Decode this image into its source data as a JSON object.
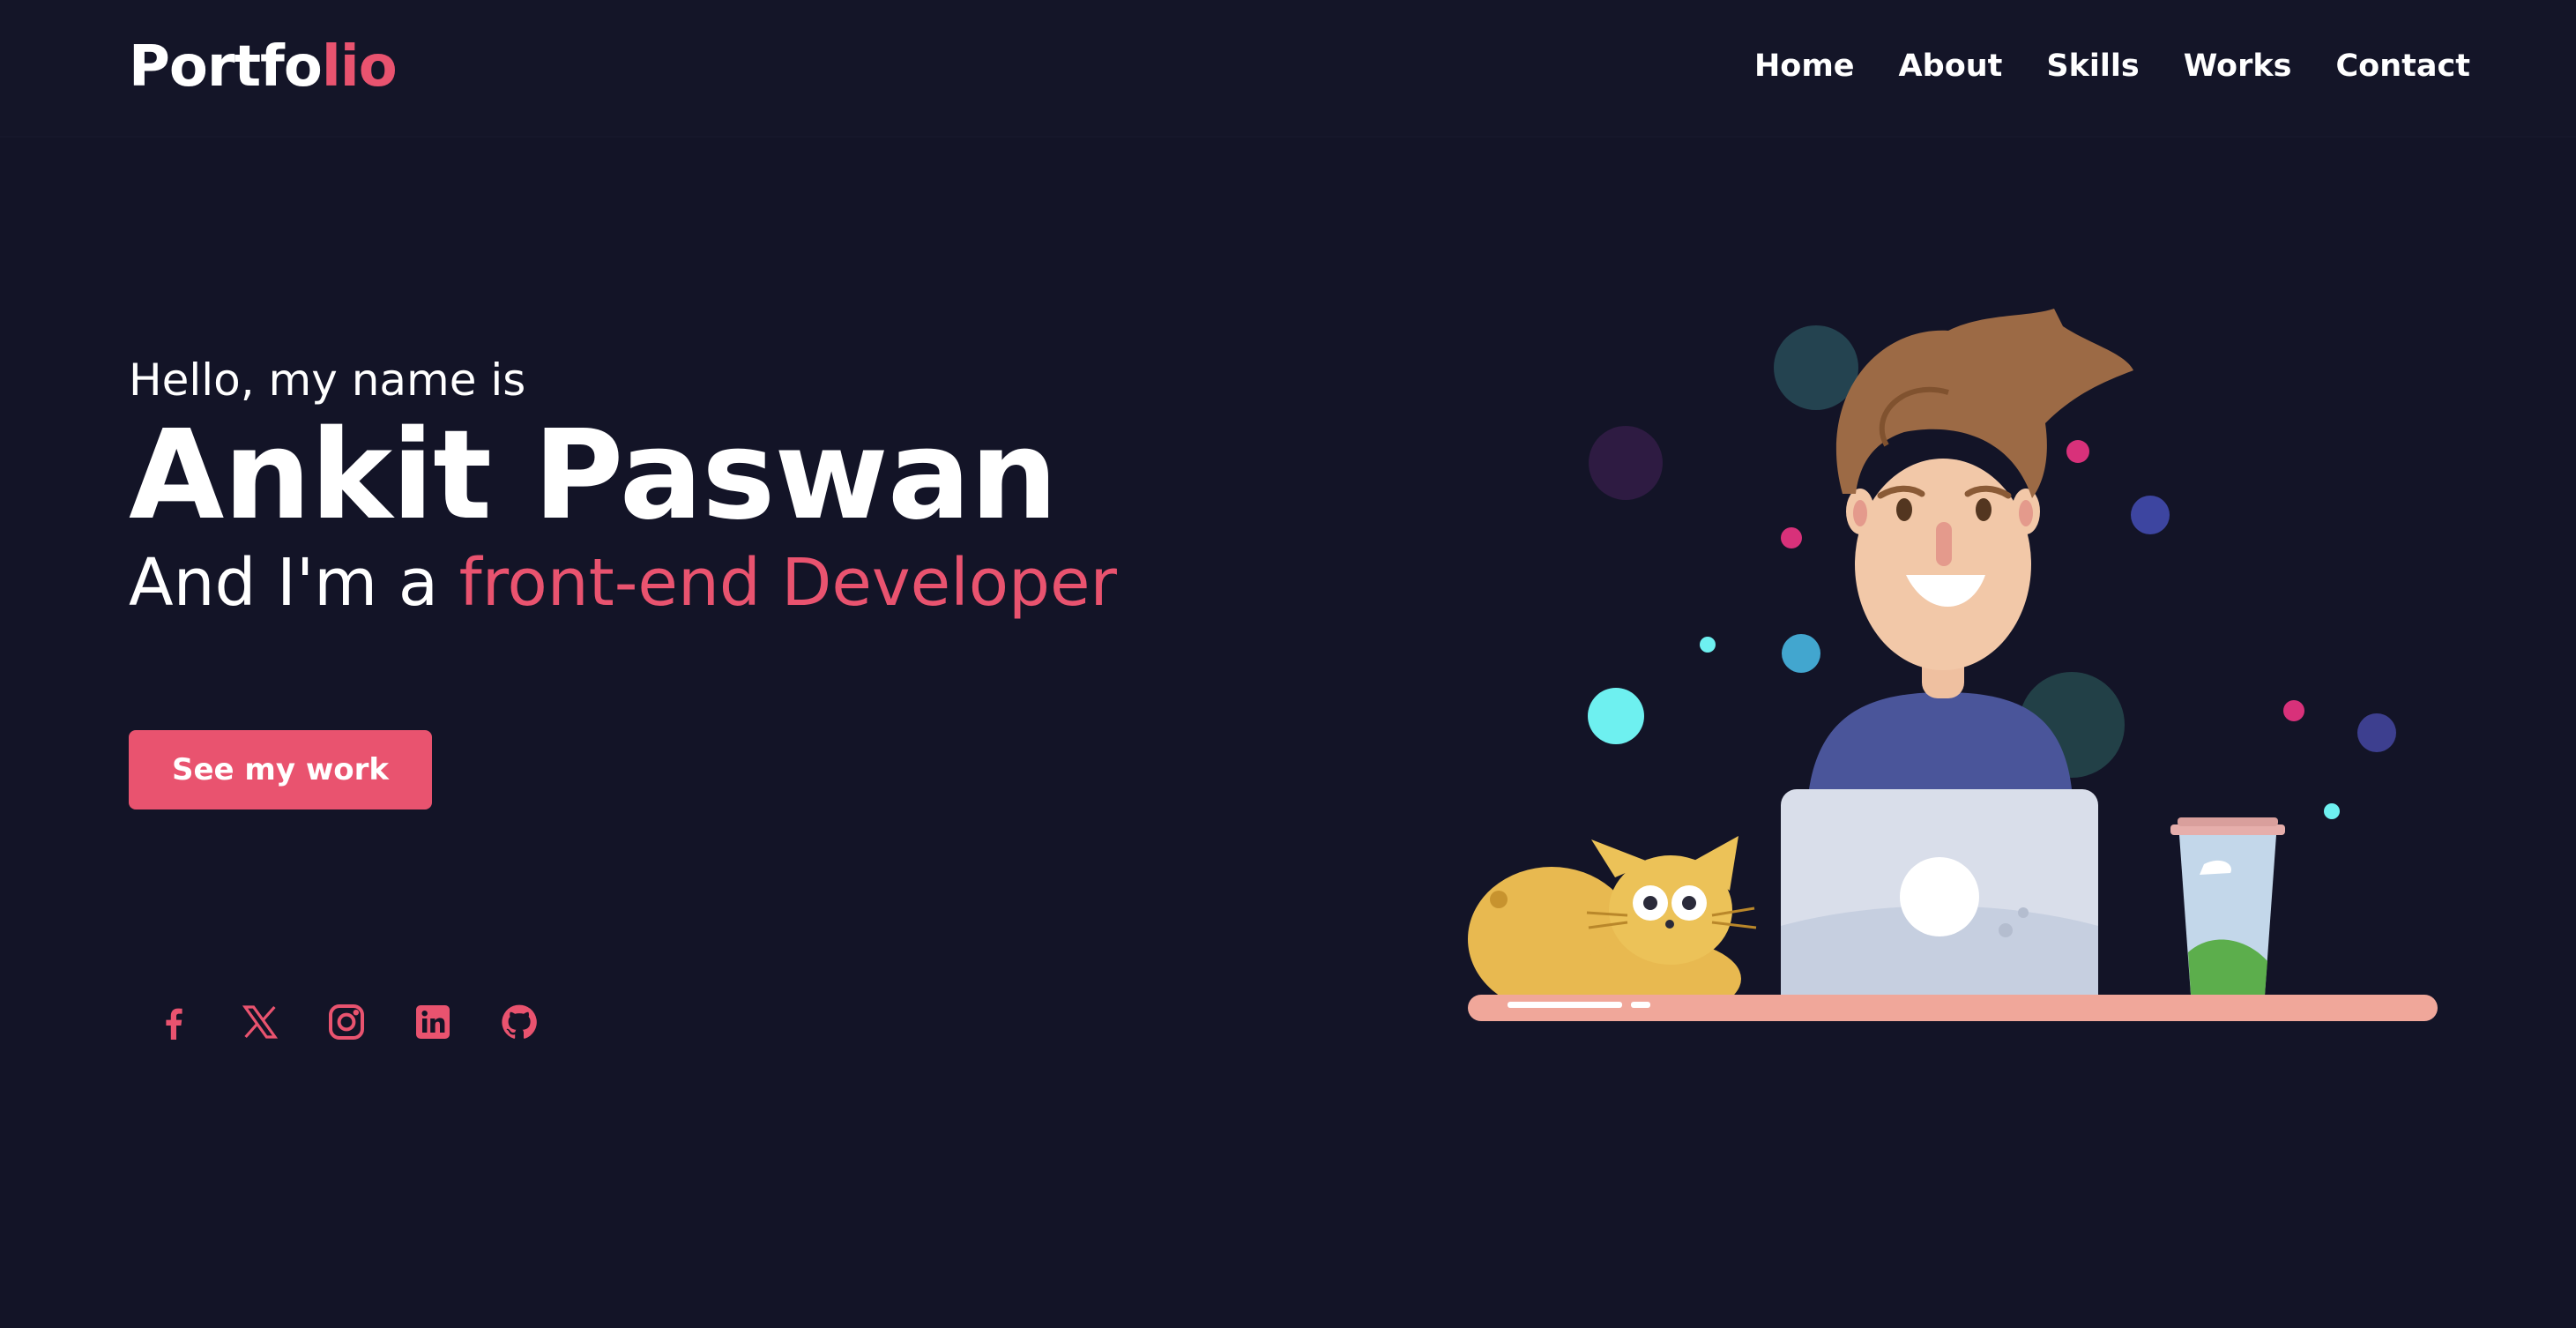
{
  "brand": {
    "logo_main": "Portfo",
    "logo_accent": "lio",
    "accent_color": "#e9536f"
  },
  "nav": {
    "items": [
      {
        "label": "Home"
      },
      {
        "label": "About"
      },
      {
        "label": "Skills"
      },
      {
        "label": "Works"
      },
      {
        "label": "Contact"
      }
    ]
  },
  "hero": {
    "greeting": "Hello, my name is",
    "name": "Ankit Paswan",
    "role_prefix": "And I'm a ",
    "role_accent": "front-end Developer",
    "cta_label": "See my work"
  },
  "socials": [
    {
      "icon": "facebook-icon"
    },
    {
      "icon": "x-twitter-icon"
    },
    {
      "icon": "instagram-icon"
    },
    {
      "icon": "linkedin-icon"
    },
    {
      "icon": "github-icon"
    }
  ],
  "colors": {
    "background": "#131427",
    "text": "#ffffff",
    "accent": "#e9536f"
  }
}
